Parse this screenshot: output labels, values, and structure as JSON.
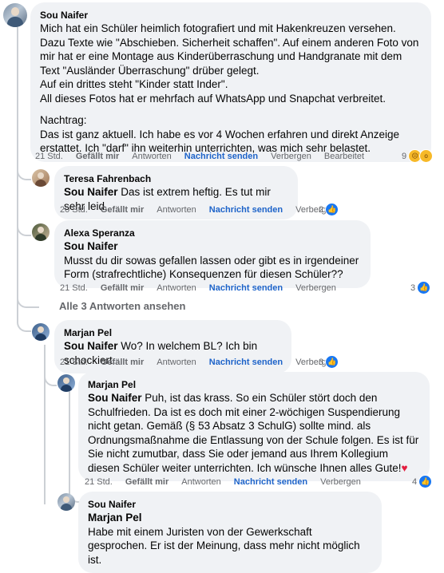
{
  "comments": [
    {
      "author": "Sou Naifer",
      "paragraphs": [
        "Mich hat ein Schüler heimlich fotografiert und mit Hakenkreuzen versehen. Dazu Texte wie \"Abschieben. Sicherheit schaffen\". Auf einem anderen Foto von mir hat er eine Montage aus Kinderüberraschung und Handgranate mit dem Text \"Ausländer Überraschung\" drüber gelegt.",
        "Auf ein drittes steht \"Kinder statt Inder\".",
        "All dieses Fotos hat er mehrfach auf WhatsApp und Snapchat verbreitet.",
        "Nachtrag:",
        "Das ist ganz aktuell. Ich habe es vor 4 Wochen erfahren und direkt Anzeige erstattet. Ich \"darf\" ihn weiterhin unterrichten, was mich sehr belastet."
      ],
      "time": "21 Std.",
      "like": "Gefällt mir",
      "reply": "Antworten",
      "message": "Nachricht senden",
      "hide": "Verbergen",
      "edit": "Bearbeitet",
      "reaction_count": "9"
    },
    {
      "author": "Teresa Fahrenbach",
      "mention": "Sou Naifer",
      "text": " Das ist extrem heftig. Es tut mir sehr leid.",
      "time": "20 Std.",
      "like": "Gefällt mir",
      "reply": "Antworten",
      "message": "Nachricht senden",
      "hide": "Verbergen",
      "reaction_count": "2"
    },
    {
      "author": "Alexa Speranza",
      "mention": "Sou Naifer",
      "text": "Musst du dir sowas gefallen lassen oder gibt es in irgendeiner Form (strafrechtliche) Konsequenzen für diesen Schüler??",
      "time": "21 Std.",
      "like": "Gefällt mir",
      "reply": "Antworten",
      "message": "Nachricht senden",
      "hide": "Verbergen",
      "reaction_count": "3",
      "view_replies": "Alle 3 Antworten ansehen"
    },
    {
      "author": "Marjan Pel",
      "mention": "Sou Naifer",
      "text": " Wo? In welchem BL? Ich bin schockiert.",
      "time": "21 Std.",
      "like": "Gefällt mir",
      "reply": "Antworten",
      "message": "Nachricht senden",
      "hide": "Verbergen",
      "reaction_count": "3"
    },
    {
      "author": "Marjan Pel",
      "mention": "Sou Naifer",
      "text": " Puh, ist das krass. So ein Schüler stört doch den Schulfrieden. Da ist es doch mit einer 2-wöchigen Suspendierung nicht getan. Gemäß (§ 53 Absatz 3 SchulG) sollte mind. als Ordnungsmaßnahme die Entlassung von der Schule folgen. Es ist für Sie nicht zumutbar, dass Sie oder jemand aus Ihrem Kollegium diesen Schüler weiter unterrichten. Ich wünsche Ihnen alles Gute!",
      "emoji": "♥",
      "time": "21 Std.",
      "like": "Gefällt mir",
      "reply": "Antworten",
      "message": "Nachricht senden",
      "hide": "Verbergen",
      "reaction_count": "4"
    },
    {
      "author": "Sou Naifer",
      "mention": "Marjan Pel",
      "text": "Habe mit einem Juristen von der Gewerkschaft gesprochen. Er ist der Meinung, dass mehr nicht möglich ist."
    }
  ],
  "icons": {
    "like": "like-icon",
    "sad": "sad-reaction-icon",
    "wow": "wow-reaction-icon",
    "heart": "heart-emoji"
  },
  "colors": {
    "bubble": "#f0f2f5",
    "link": "#1d63c9",
    "like": "#1877f2",
    "meta": "#65676b"
  }
}
